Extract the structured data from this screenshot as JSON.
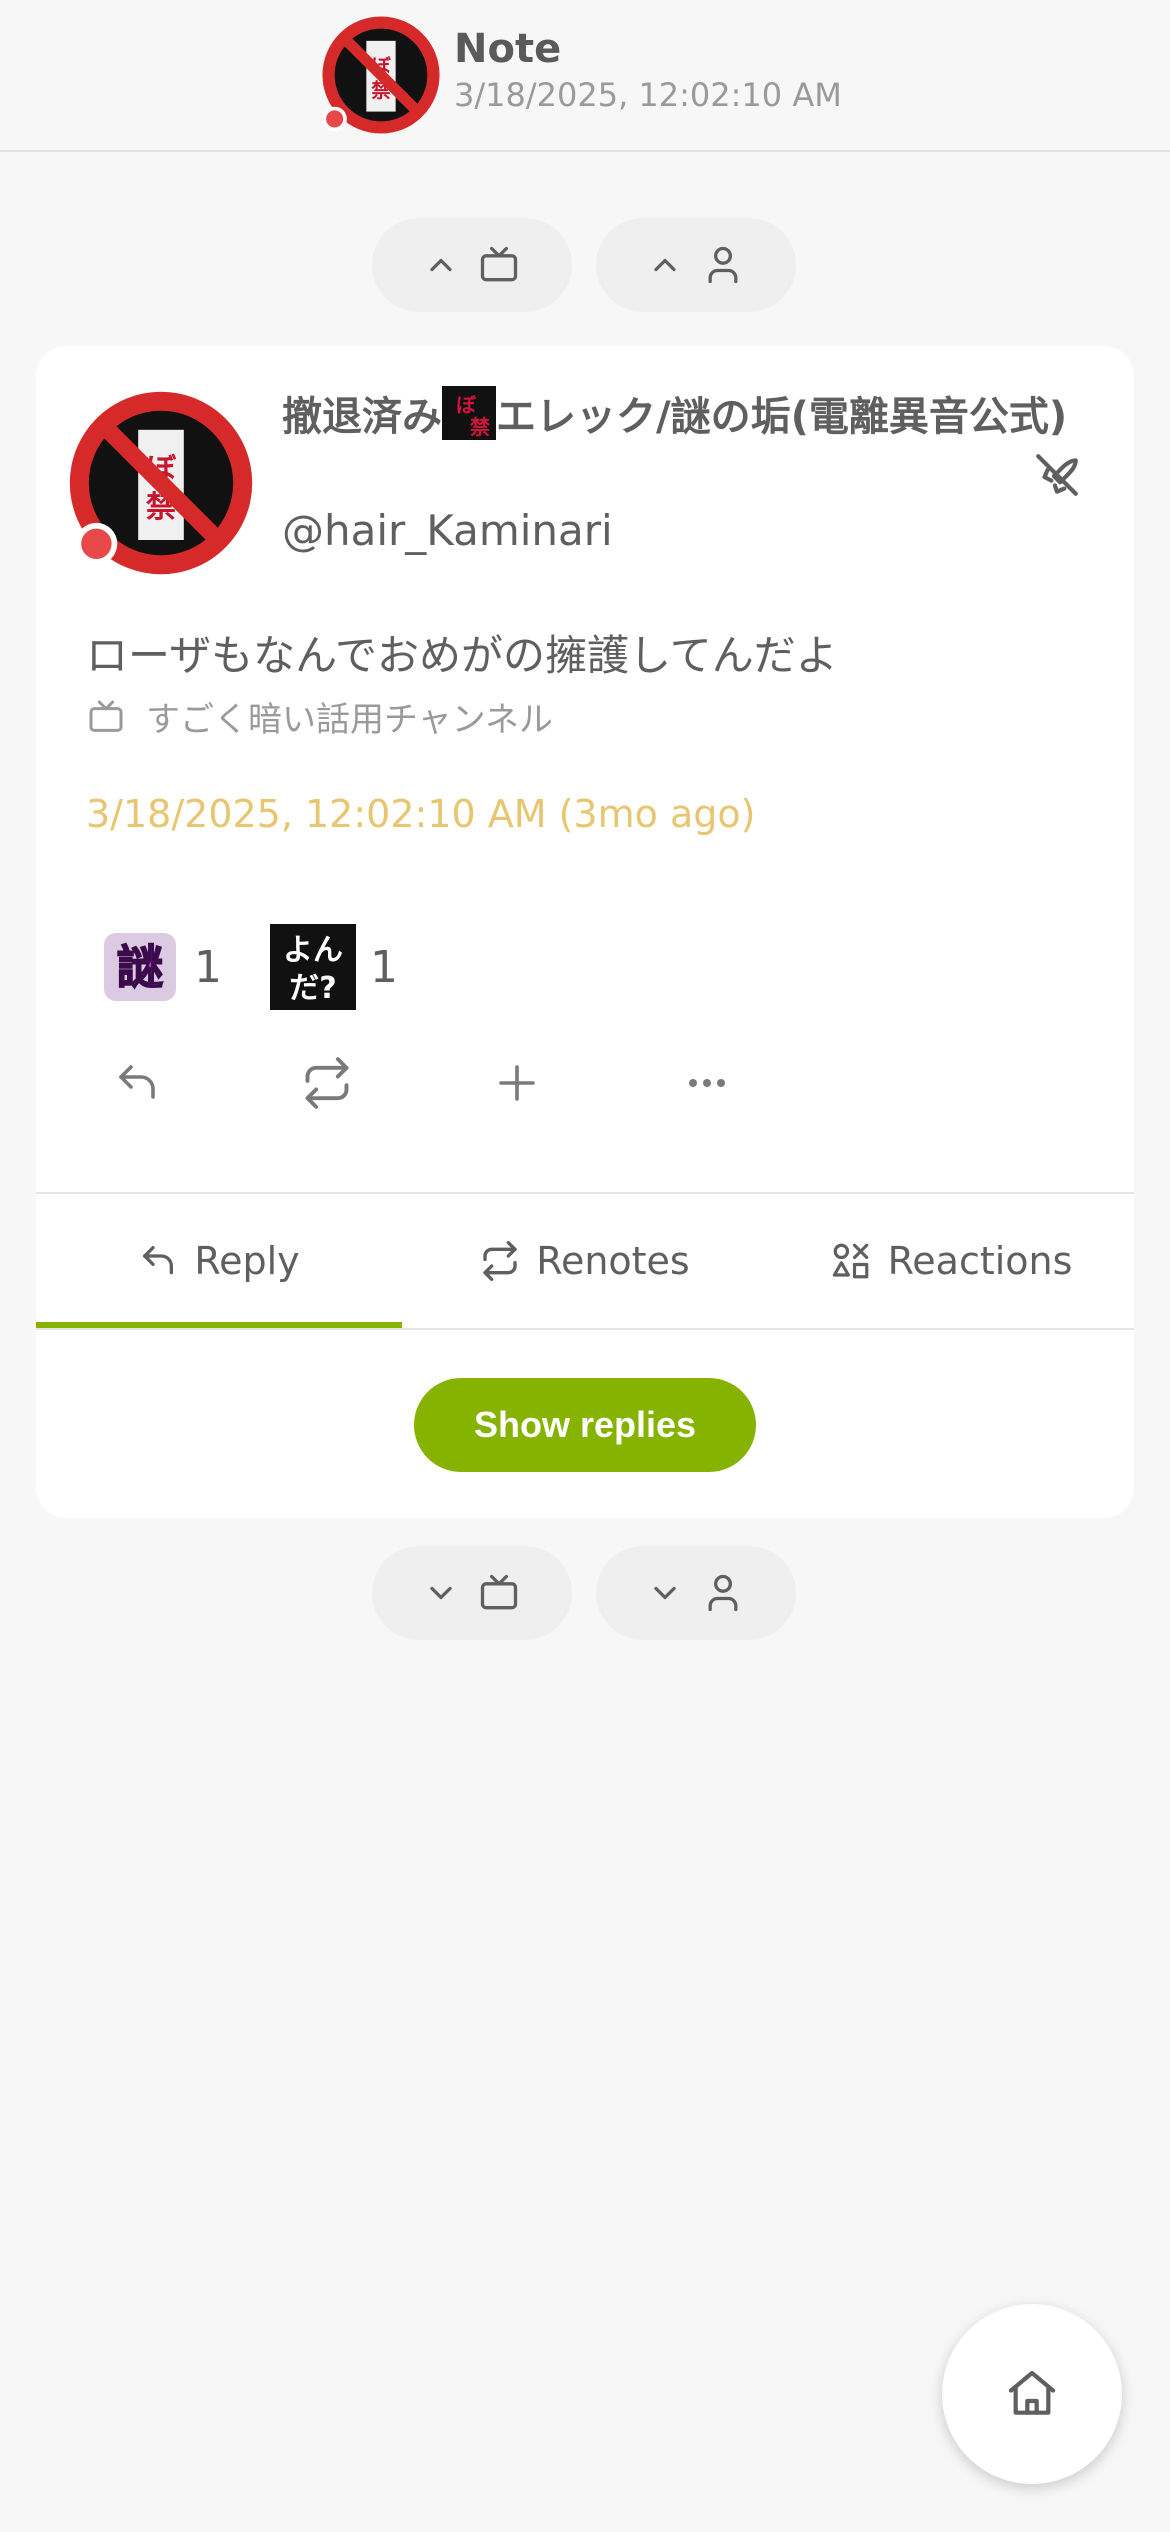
{
  "header": {
    "title": "Note",
    "timestamp": "3/18/2025, 12:02:10 AM",
    "avatar_icon": "prohibited-sign-avatar"
  },
  "nav_top": {
    "prev_channel_icon": "chevron-up-tv-icon",
    "prev_user_icon": "chevron-up-user-icon"
  },
  "note": {
    "user": {
      "name_part1": "撤退済み",
      "name_part2": "エレック/謎の垢(電離異音公式)",
      "handle": "@hair_Kaminari"
    },
    "text": "ローザもなんでおめがの擁護してんだよ",
    "channel": "すごく暗い話用チャンネル",
    "time": "3/18/2025, 12:02:10 AM (3mo ago)",
    "reactions": [
      {
        "emoji": "nazo-emoji",
        "label": "謎",
        "count": "1"
      },
      {
        "emoji": "yonda-emoji",
        "label": "よんだ?",
        "count": "1"
      }
    ],
    "actions": [
      "reply-icon",
      "renote-icon",
      "plus-icon",
      "more-icon"
    ]
  },
  "tabs": {
    "reply": "Reply",
    "renotes": "Renotes",
    "reactions": "Reactions"
  },
  "show_replies": "Show replies",
  "colors": {
    "accent": "#86b300",
    "time": "#e8c570",
    "background": "#f7f7f7"
  }
}
